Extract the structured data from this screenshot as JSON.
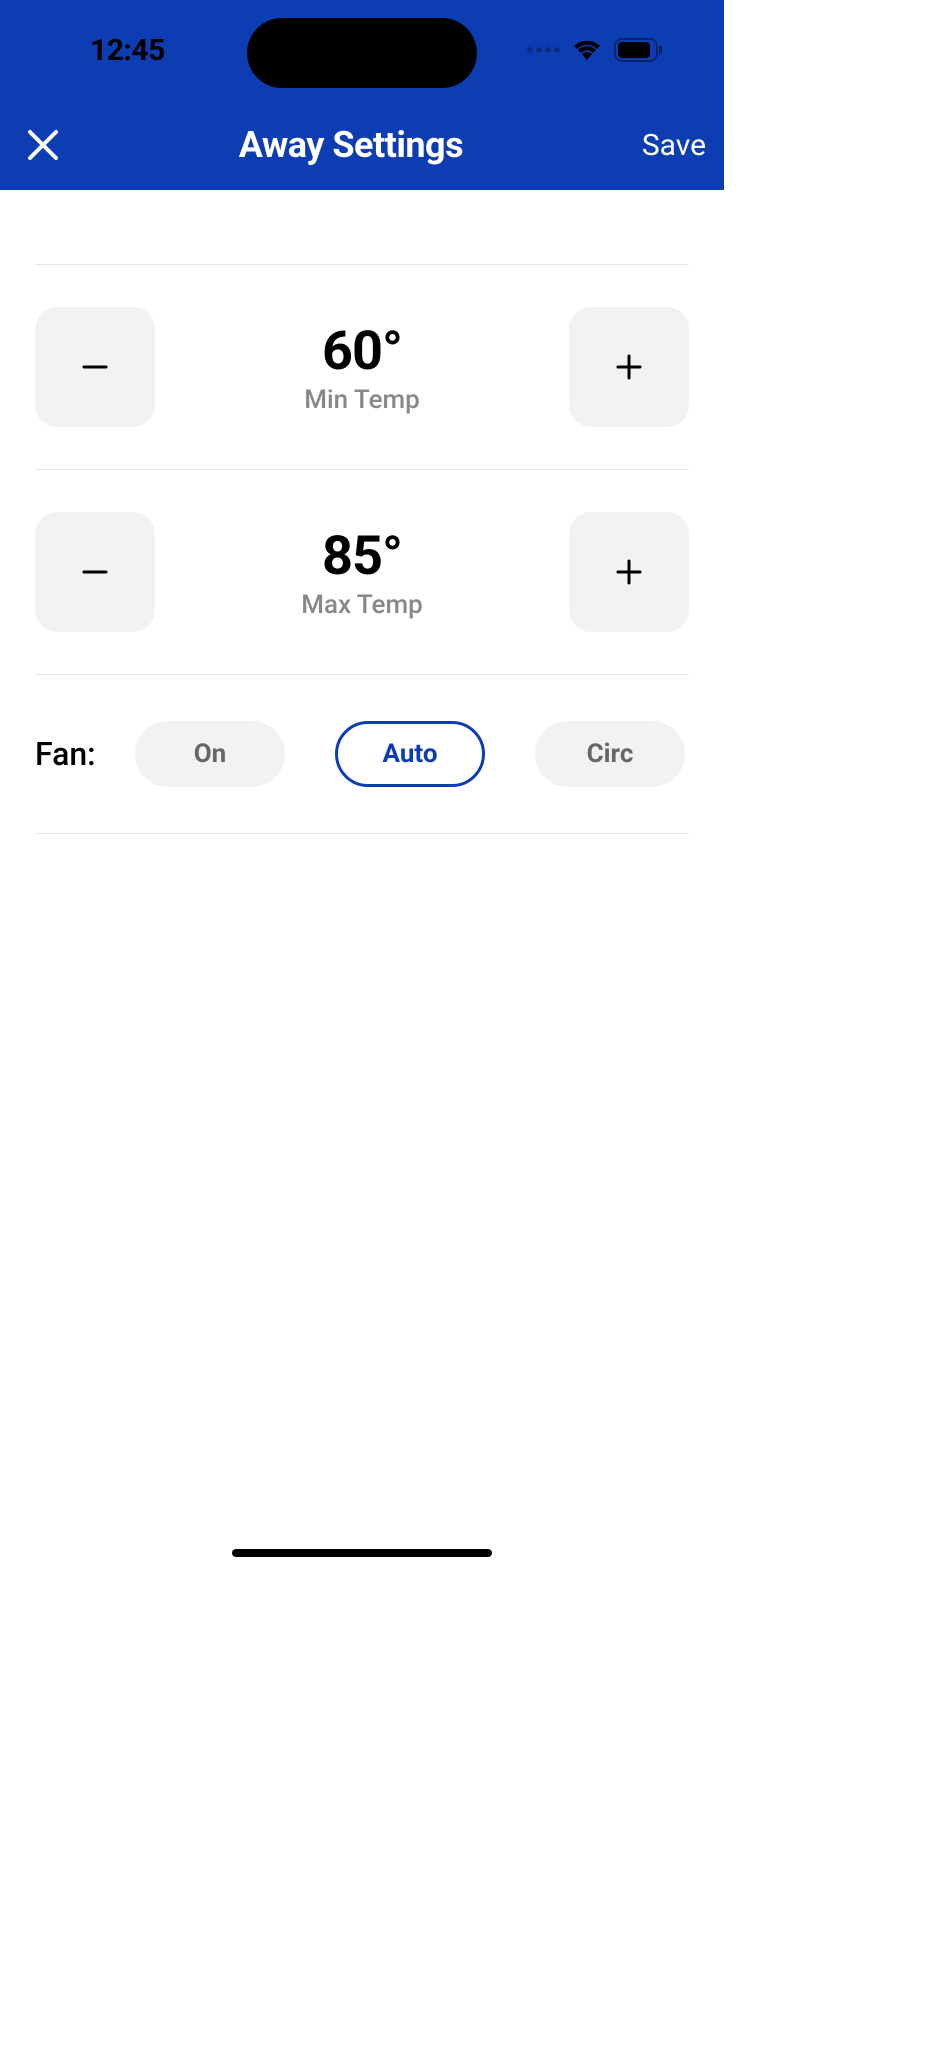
{
  "statusBar": {
    "time": "12:45"
  },
  "header": {
    "title": "Away Settings",
    "save_label": "Save"
  },
  "minTemp": {
    "value": "60°",
    "label": "Min Temp"
  },
  "maxTemp": {
    "value": "85°",
    "label": "Max Temp"
  },
  "fan": {
    "label": "Fan:",
    "options": {
      "on": "On",
      "auto": "Auto",
      "circ": "Circ"
    },
    "selected": "Auto"
  },
  "colors": {
    "brand": "#0d3db2",
    "muted": "#888888",
    "button_bg": "#f2f2f2"
  }
}
